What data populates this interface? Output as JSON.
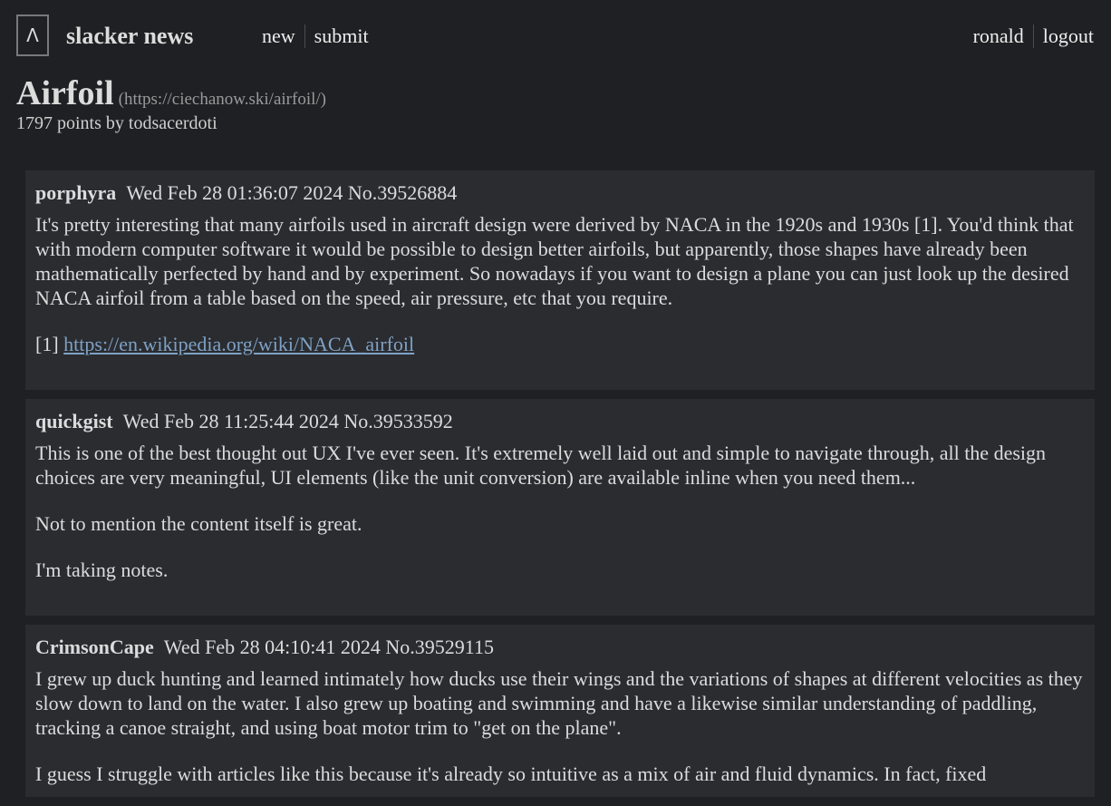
{
  "header": {
    "logo_symbol": "Λ",
    "site_name": "slacker news",
    "nav": [
      "new",
      "submit"
    ],
    "user": "ronald",
    "logout": "logout"
  },
  "story": {
    "title": "Airfoil",
    "url": "(https://ciechanow.ski/airfoil/)",
    "meta": "1797 points by todsacerdoti"
  },
  "comments": [
    {
      "author": "porphyra",
      "meta": "Wed Feb 28 01:36:07 2024 No.39526884",
      "para1": "It's pretty interesting that many airfoils used in aircraft design were derived by NACA in the 1920s and 1930s [1]. You'd think that with modern computer software it would be possible to design better airfoils, but apparently, those shapes have already been mathematically perfected by hand and by experiment. So nowadays if you want to design a plane you can just look up the desired NACA airfoil from a table based on the speed, air pressure, etc that you require.",
      "ref_prefix": "[1]",
      "ref_link": "https://en.wikipedia.org/wiki/NACA_airfoil"
    },
    {
      "author": "quickgist",
      "meta": "Wed Feb 28 11:25:44 2024 No.39533592",
      "para1": "This is one of the best thought out UX I've ever seen. It's extremely well laid out and simple to navigate through, all the design choices are very meaningful, UI elements (like the unit conversion) are available inline when you need them...",
      "para2": "Not to mention the content itself is great.",
      "para3": "I'm taking notes."
    },
    {
      "author": "CrimsonCape",
      "meta": "Wed Feb 28 04:10:41 2024 No.39529115",
      "para1": "I grew up duck hunting and learned intimately how ducks use their wings and the variations of shapes at different velocities as they slow down to land on the water. I also grew up boating and swimming and have a likewise similar understanding of paddling, tracking a canoe straight, and using boat motor trim to \"get on the plane\".",
      "para2": "I guess I struggle with articles like this because it's already so intuitive as a mix of air and fluid dynamics. In fact, fixed"
    }
  ]
}
